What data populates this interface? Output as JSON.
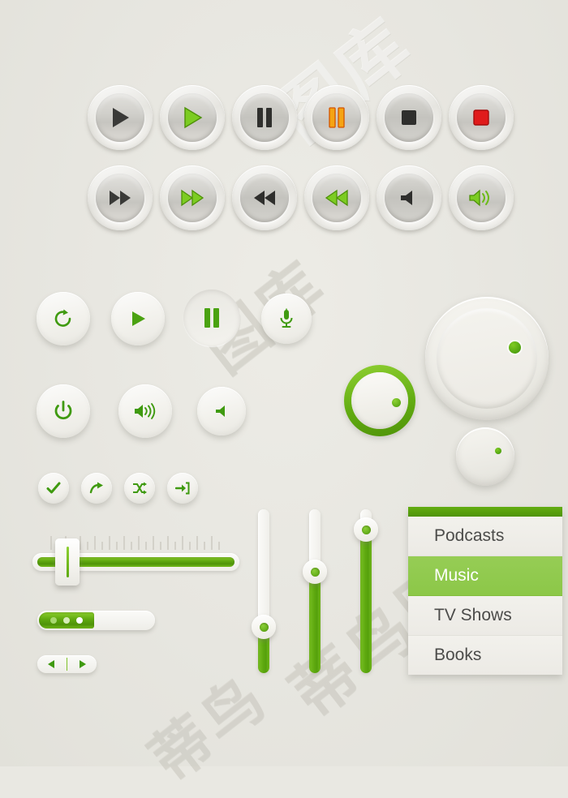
{
  "palette": {
    "background": "#e9e8e2",
    "green": "#5fa80f",
    "green_light": "#8ccf2e",
    "green_menu_sel": "#8cc748",
    "orange": "#f0900c",
    "red": "#e01b1b",
    "dark_icon": "#3a3a38",
    "text": "#4c4c4a"
  },
  "watermark": {
    "line1": "图库",
    "line2": "蒂鸟图库",
    "line3": "蒂鸟"
  },
  "button_rows": {
    "row1": [
      {
        "name": "play-button-gray",
        "icon": "play",
        "state": "default",
        "color": "#3a3a38"
      },
      {
        "name": "play-button-green",
        "icon": "play",
        "state": "active",
        "color": "#6dbf1a"
      },
      {
        "name": "pause-button-gray",
        "icon": "pause",
        "state": "default",
        "color": "#3a3a38"
      },
      {
        "name": "pause-button-orange",
        "icon": "pause",
        "state": "active",
        "color": "#f0900c"
      },
      {
        "name": "stop-button-gray",
        "icon": "stop",
        "state": "default",
        "color": "#3a3a38"
      },
      {
        "name": "record-button-red",
        "icon": "stop",
        "state": "active",
        "color": "#e01b1b"
      }
    ],
    "row2": [
      {
        "name": "fast-forward-button-gray",
        "icon": "forward",
        "state": "default",
        "color": "#3a3a38"
      },
      {
        "name": "fast-forward-button-green",
        "icon": "forward",
        "state": "active",
        "color": "#6dbf1a"
      },
      {
        "name": "rewind-button-gray",
        "icon": "rewind",
        "state": "default",
        "color": "#3a3a38"
      },
      {
        "name": "rewind-button-green",
        "icon": "rewind",
        "state": "active",
        "color": "#6dbf1a"
      },
      {
        "name": "mute-button-gray",
        "icon": "volume-mute",
        "state": "default",
        "color": "#3a3a38"
      },
      {
        "name": "volume-button-green",
        "icon": "volume-up",
        "state": "active",
        "color": "#6dbf1a"
      }
    ]
  },
  "soft_buttons": {
    "row1": [
      {
        "name": "refresh-button",
        "icon": "refresh",
        "state": "normal"
      },
      {
        "name": "play-button",
        "icon": "play",
        "state": "normal"
      },
      {
        "name": "pause-button",
        "icon": "pause",
        "state": "pressed"
      },
      {
        "name": "microphone-button",
        "icon": "microphone",
        "state": "normal"
      }
    ],
    "row2": [
      {
        "name": "power-button",
        "icon": "power",
        "state": "normal"
      },
      {
        "name": "volume-up-button",
        "icon": "volume-up",
        "state": "normal"
      },
      {
        "name": "volume-mute-button",
        "icon": "volume-mute",
        "state": "normal"
      }
    ],
    "row3": [
      {
        "name": "confirm-button",
        "icon": "check"
      },
      {
        "name": "share-button",
        "icon": "share-arrow"
      },
      {
        "name": "shuffle-button",
        "icon": "shuffle"
      },
      {
        "name": "login-button",
        "icon": "login-arrow"
      }
    ]
  },
  "knobs": [
    {
      "name": "knob-large-plain",
      "style": "plain",
      "indicator_angle": 45,
      "size": 132
    },
    {
      "name": "knob-small-plain",
      "style": "plain",
      "indicator_angle": 45,
      "size": 66
    },
    {
      "name": "knob-green-ring",
      "style": "ring",
      "indicator_angle": 40,
      "size": 88
    }
  ],
  "horizontal_slider": {
    "name": "volume-slider",
    "value_percent": 12,
    "tick_count": 24,
    "fill_percent": 100
  },
  "toggle": {
    "name": "toggle-switch",
    "state": "on",
    "dots": 3
  },
  "stepper": {
    "name": "stepper-control",
    "left_icon": "triangle-left",
    "right_icon": "triangle-right"
  },
  "vertical_sliders": [
    {
      "name": "vertical-slider-1",
      "value_percent": 28
    },
    {
      "name": "vertical-slider-2",
      "value_percent": 62
    },
    {
      "name": "vertical-slider-3",
      "value_percent": 88
    }
  ],
  "menu": {
    "name": "media-list-menu",
    "selected": "Music",
    "items": [
      {
        "label": "Podcasts",
        "selected": false
      },
      {
        "label": "Music",
        "selected": true
      },
      {
        "label": "TV Shows",
        "selected": false
      },
      {
        "label": "Books",
        "selected": false
      }
    ]
  }
}
